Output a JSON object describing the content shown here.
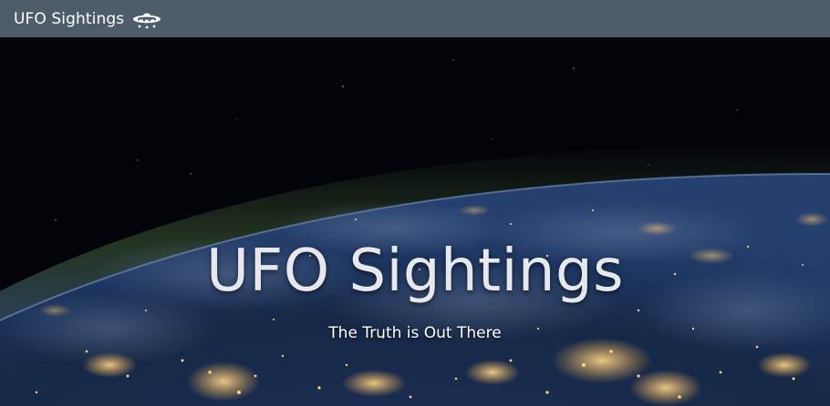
{
  "navbar": {
    "brand_label": "UFO Sightings",
    "brand_icon": "ufo-icon"
  },
  "hero": {
    "title": "UFO Sightings",
    "subtitle": "The Truth is Out There",
    "background": "earth-at-night-from-space"
  },
  "colors": {
    "navbar_bg": "#4f5d6b",
    "text": "#ffffff",
    "city_lights": "#f5c06a",
    "atmosphere": "#2f4a2a"
  }
}
